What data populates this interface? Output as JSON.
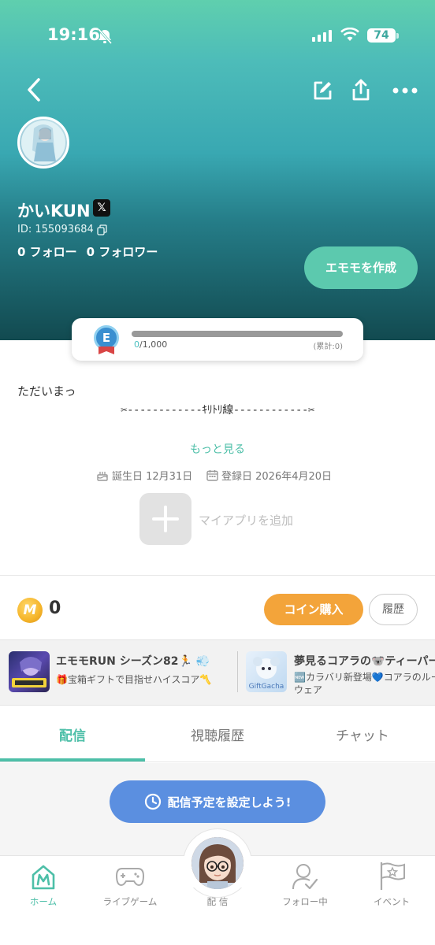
{
  "status_bar": {
    "time": "19:16",
    "battery": "74"
  },
  "header": {
    "back_icon": "chevron-left-icon",
    "edit_icon": "edit-icon",
    "share_icon": "share-icon",
    "more_icon": "more-horizontal-icon"
  },
  "profile": {
    "name": "かいKUN",
    "x_badge": "𝕏",
    "id_text": "ID: 155093684",
    "following": "0 フォロー",
    "followers": "0 フォロワー",
    "create_button": "エモモを作成"
  },
  "level": {
    "badge": "E",
    "current": "0",
    "max": "/1,000",
    "total": "(累計:0)",
    "progress": 0
  },
  "bio": {
    "line1": "ただいまっ",
    "line2": "✂------------ｷﾘﾄﾘ線------------✂",
    "more": "もっと見る",
    "birthday": "誕生日 12月31日",
    "registered": "登録日 2026年4月20日"
  },
  "myapp": {
    "label": "マイアプリを追加"
  },
  "coins": {
    "value": "0",
    "buy_button": "コイン購入",
    "history_button": "履歴"
  },
  "banners": [
    {
      "title": "エモモRUN シーズン82🏃 💨",
      "subtitle": "🎁宝箱ギフトで目指せハイスコア〽️"
    },
    {
      "title": "夢見るコアラの🐨ティーパーティ",
      "subtitle_line1": "🆕カラバリ新登場💙コアラのルー",
      "subtitle_line2": "ウェア"
    }
  ],
  "tabs": [
    {
      "label": "配信"
    },
    {
      "label": "視聴履歴"
    },
    {
      "label": "チャット"
    }
  ],
  "schedule_button": "配信予定を設定しよう!",
  "bottom_nav": [
    {
      "label": "ホーム",
      "icon": "home-m-icon"
    },
    {
      "label": "ライブゲーム",
      "icon": "gamepad-icon"
    },
    {
      "label": "配 信",
      "icon": "avatar"
    },
    {
      "label": "フォロー中",
      "icon": "follow-icon"
    },
    {
      "label": "イベント",
      "icon": "flag-icon"
    }
  ],
  "colors": {
    "accent": "#4dbfa8",
    "coin_button": "#f3a43a",
    "schedule_button": "#5b8fe0"
  }
}
